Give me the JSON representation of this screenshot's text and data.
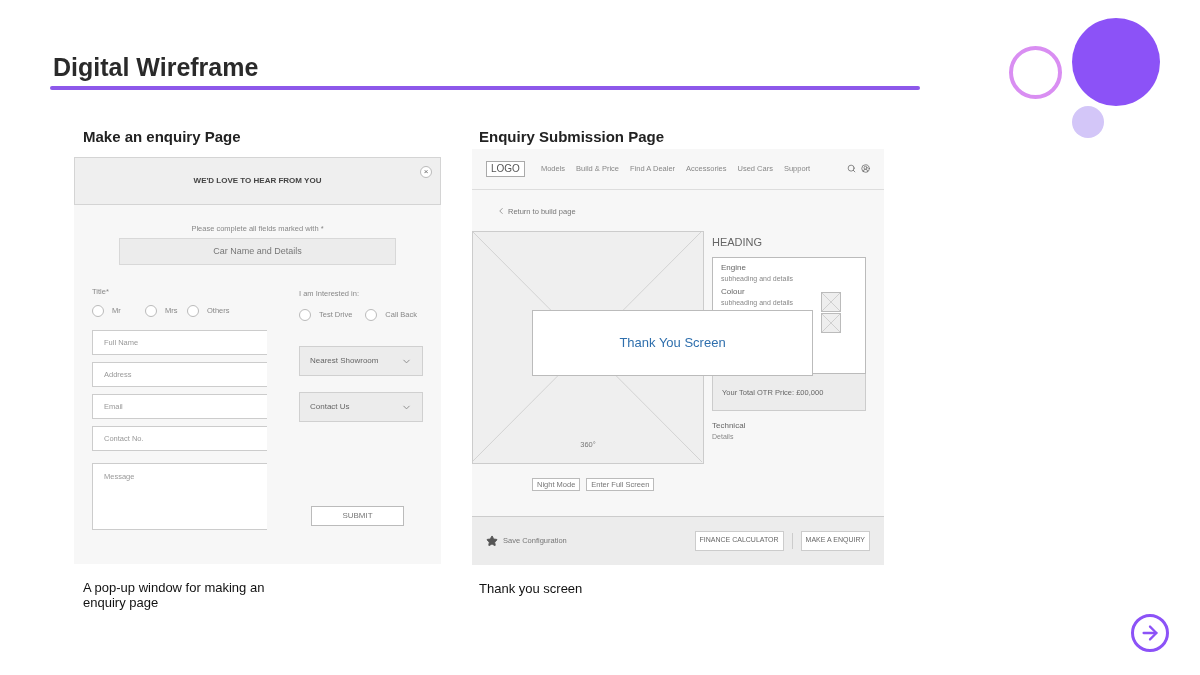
{
  "title": "Digital Wireframe",
  "sections": [
    {
      "heading": "Make an enquiry Page",
      "caption": "A pop-up window for making an enquiry page"
    },
    {
      "heading": "Enquiry Submission Page",
      "caption": "Thank you screen"
    }
  ],
  "enquiry_popup": {
    "title": "WE'D LOVE TO HEAR FROM YOU",
    "close": "×",
    "note": "Please complete all fields marked with *",
    "car_field": "Car Name and Details",
    "title_label": "Title*",
    "title_options": [
      {
        "label": "Mr",
        "selected": false
      },
      {
        "label": "Mrs",
        "selected": false
      },
      {
        "label": "Others",
        "selected": false
      }
    ],
    "fields": [
      {
        "placeholder": "Full Name"
      },
      {
        "placeholder": "Address"
      },
      {
        "placeholder": "Email"
      },
      {
        "placeholder": "Contact No."
      }
    ],
    "message": {
      "placeholder": "Message"
    },
    "interest_label": "I am Interested in:",
    "interest_options": [
      {
        "label": "Test Drive",
        "selected": false
      },
      {
        "label": "Call Back",
        "selected": false
      }
    ],
    "dropdowns": [
      "Nearest Showroom",
      "Contact Us"
    ],
    "submit": "SUBMIT"
  },
  "submission_page": {
    "logo": "LOGO",
    "nav": [
      "Models",
      "Build & Price",
      "Find A Dealer",
      "Accessories",
      "Used Cars",
      "Support"
    ],
    "back_link": "Return to build page",
    "image_label": "360°",
    "heading": "HEADING",
    "specs": [
      {
        "name": "Engine",
        "detail": "subheading and details"
      },
      {
        "name": "Colour",
        "detail": "subheading and details"
      }
    ],
    "price": "Your Total OTR Price: £00,000",
    "technical": {
      "name": "Technical",
      "detail": "Details"
    },
    "view_buttons": [
      "Night Mode",
      "Enter Full Screen"
    ],
    "save": "Save Configuration",
    "footer_buttons": [
      "FINANCE CALCULATOR",
      "MAKE A ENQUIRY"
    ],
    "overlay": "Thank You Screen"
  }
}
